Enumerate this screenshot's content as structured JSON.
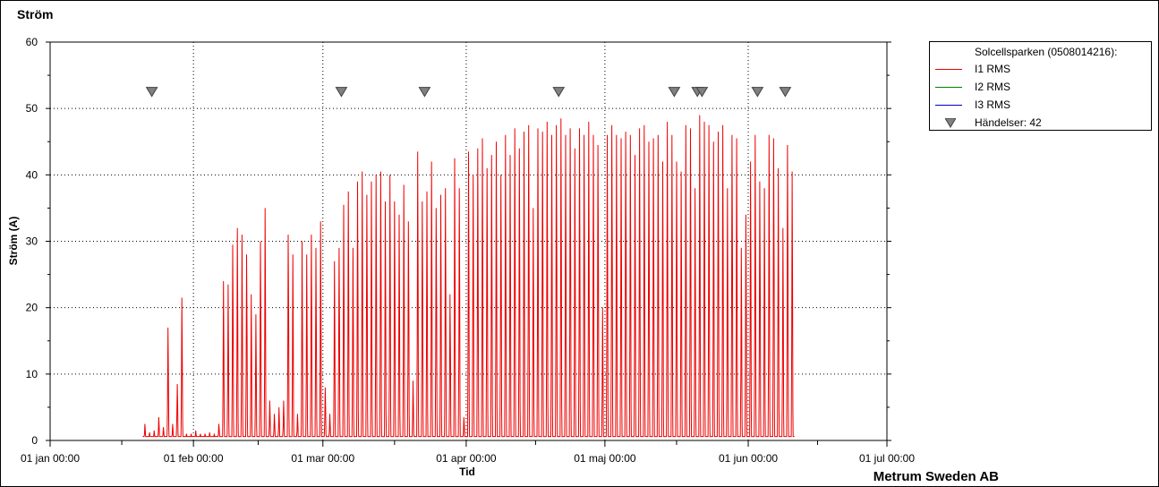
{
  "title": "Ström",
  "company": "Metrum Sweden AB",
  "legend": {
    "header": "Solcellsparken (0508014216):",
    "items": [
      {
        "label": "I1 RMS",
        "color": "#ee0000",
        "kind": "line"
      },
      {
        "label": "I2 RMS",
        "color": "#008000",
        "kind": "line"
      },
      {
        "label": "I3 RMS",
        "color": "#0000cc",
        "kind": "line"
      },
      {
        "label": "Händelser: 42",
        "color": "#808080",
        "kind": "marker"
      }
    ]
  },
  "chart_data": {
    "type": "line",
    "title": "Ström",
    "xlabel": "Tid",
    "ylabel": "Ström (A)",
    "ylim": [
      0,
      60
    ],
    "yticks": [
      0,
      10,
      20,
      30,
      40,
      50,
      60
    ],
    "x_tick_labels": [
      "01 jan 00:00",
      "01 feb 00:00",
      "01 mar 00:00",
      "01 apr 00:00",
      "01 maj 00:00",
      "01 jun 00:00",
      "01 jul 00:00"
    ],
    "x_tick_days": [
      0,
      31,
      59,
      90,
      120,
      151,
      181
    ],
    "xlim_days": [
      0,
      181
    ],
    "grid": true,
    "legend_position": "top-right",
    "series": [
      {
        "name": "I1 RMS",
        "color": "#ee0000",
        "daily_peaks": [
          {
            "day": 20,
            "peak": 2.5
          },
          {
            "day": 21,
            "peak": 1.2
          },
          {
            "day": 22,
            "peak": 1.5
          },
          {
            "day": 23,
            "peak": 3.5
          },
          {
            "day": 24,
            "peak": 2.0
          },
          {
            "day": 25,
            "peak": 17.0
          },
          {
            "day": 26,
            "peak": 2.5
          },
          {
            "day": 27,
            "peak": 8.5
          },
          {
            "day": 28,
            "peak": 21.5
          },
          {
            "day": 29,
            "peak": 1.0
          },
          {
            "day": 30,
            "peak": 1.0
          },
          {
            "day": 31,
            "peak": 1.5
          },
          {
            "day": 32,
            "peak": 1.0
          },
          {
            "day": 33,
            "peak": 1.0
          },
          {
            "day": 34,
            "peak": 1.2
          },
          {
            "day": 35,
            "peak": 1.0
          },
          {
            "day": 36,
            "peak": 2.5
          },
          {
            "day": 37,
            "peak": 24.0
          },
          {
            "day": 38,
            "peak": 23.5
          },
          {
            "day": 39,
            "peak": 29.5
          },
          {
            "day": 40,
            "peak": 32.0
          },
          {
            "day": 41,
            "peak": 31.0
          },
          {
            "day": 42,
            "peak": 28.0
          },
          {
            "day": 43,
            "peak": 22.0
          },
          {
            "day": 44,
            "peak": 19.0
          },
          {
            "day": 45,
            "peak": 30.0
          },
          {
            "day": 46,
            "peak": 35.0
          },
          {
            "day": 47,
            "peak": 6.0
          },
          {
            "day": 48,
            "peak": 4.0
          },
          {
            "day": 49,
            "peak": 5.0
          },
          {
            "day": 50,
            "peak": 6.0
          },
          {
            "day": 51,
            "peak": 31.0
          },
          {
            "day": 52,
            "peak": 28.0
          },
          {
            "day": 53,
            "peak": 4.0
          },
          {
            "day": 54,
            "peak": 30.0
          },
          {
            "day": 55,
            "peak": 28.0
          },
          {
            "day": 56,
            "peak": 31.0
          },
          {
            "day": 57,
            "peak": 29.0
          },
          {
            "day": 58,
            "peak": 33.0
          },
          {
            "day": 59,
            "peak": 8.0
          },
          {
            "day": 60,
            "peak": 4.0
          },
          {
            "day": 61,
            "peak": 27.0
          },
          {
            "day": 62,
            "peak": 29.0
          },
          {
            "day": 63,
            "peak": 35.5
          },
          {
            "day": 64,
            "peak": 37.5
          },
          {
            "day": 65,
            "peak": 29.0
          },
          {
            "day": 66,
            "peak": 39.0
          },
          {
            "day": 67,
            "peak": 40.5
          },
          {
            "day": 68,
            "peak": 37.0
          },
          {
            "day": 69,
            "peak": 39.0
          },
          {
            "day": 70,
            "peak": 40.0
          },
          {
            "day": 71,
            "peak": 40.5
          },
          {
            "day": 72,
            "peak": 36.0
          },
          {
            "day": 73,
            "peak": 40.0
          },
          {
            "day": 74,
            "peak": 36.0
          },
          {
            "day": 75,
            "peak": 34.0
          },
          {
            "day": 76,
            "peak": 38.5
          },
          {
            "day": 77,
            "peak": 33.0
          },
          {
            "day": 78,
            "peak": 9.0
          },
          {
            "day": 79,
            "peak": 43.5
          },
          {
            "day": 80,
            "peak": 36.0
          },
          {
            "day": 81,
            "peak": 37.5
          },
          {
            "day": 82,
            "peak": 42.0
          },
          {
            "day": 83,
            "peak": 35.0
          },
          {
            "day": 84,
            "peak": 37.0
          },
          {
            "day": 85,
            "peak": 38.0
          },
          {
            "day": 86,
            "peak": 22.0
          },
          {
            "day": 87,
            "peak": 42.5
          },
          {
            "day": 88,
            "peak": 38.0
          },
          {
            "day": 89,
            "peak": 3.5
          },
          {
            "day": 90,
            "peak": 43.5
          },
          {
            "day": 91,
            "peak": 40.0
          },
          {
            "day": 92,
            "peak": 44.0
          },
          {
            "day": 93,
            "peak": 45.5
          },
          {
            "day": 94,
            "peak": 41.0
          },
          {
            "day": 95,
            "peak": 43.0
          },
          {
            "day": 96,
            "peak": 45.0
          },
          {
            "day": 97,
            "peak": 40.0
          },
          {
            "day": 98,
            "peak": 46.0
          },
          {
            "day": 99,
            "peak": 43.0
          },
          {
            "day": 100,
            "peak": 47.0
          },
          {
            "day": 101,
            "peak": 44.0
          },
          {
            "day": 102,
            "peak": 46.5
          },
          {
            "day": 103,
            "peak": 47.5
          },
          {
            "day": 104,
            "peak": 35.0
          },
          {
            "day": 105,
            "peak": 47.0
          },
          {
            "day": 106,
            "peak": 46.5
          },
          {
            "day": 107,
            "peak": 48.0
          },
          {
            "day": 108,
            "peak": 46.0
          },
          {
            "day": 109,
            "peak": 47.5
          },
          {
            "day": 110,
            "peak": 48.5
          },
          {
            "day": 111,
            "peak": 46.0
          },
          {
            "day": 112,
            "peak": 47.0
          },
          {
            "day": 113,
            "peak": 44.0
          },
          {
            "day": 114,
            "peak": 47.0
          },
          {
            "day": 115,
            "peak": 46.0
          },
          {
            "day": 116,
            "peak": 48.0
          },
          {
            "day": 117,
            "peak": 46.0
          },
          {
            "day": 118,
            "peak": 44.5
          },
          {
            "day": 119,
            "peak": 20.0
          },
          {
            "day": 120,
            "peak": 46.0
          },
          {
            "day": 121,
            "peak": 47.5
          },
          {
            "day": 122,
            "peak": 46.0
          },
          {
            "day": 123,
            "peak": 45.5
          },
          {
            "day": 124,
            "peak": 46.5
          },
          {
            "day": 125,
            "peak": 46.0
          },
          {
            "day": 126,
            "peak": 43.0
          },
          {
            "day": 127,
            "peak": 47.0
          },
          {
            "day": 128,
            "peak": 47.5
          },
          {
            "day": 129,
            "peak": 45.0
          },
          {
            "day": 130,
            "peak": 45.5
          },
          {
            "day": 131,
            "peak": 46.0
          },
          {
            "day": 132,
            "peak": 42.0
          },
          {
            "day": 133,
            "peak": 48.0
          },
          {
            "day": 134,
            "peak": 46.0
          },
          {
            "day": 135,
            "peak": 42.0
          },
          {
            "day": 136,
            "peak": 40.5
          },
          {
            "day": 137,
            "peak": 47.5
          },
          {
            "day": 138,
            "peak": 47.0
          },
          {
            "day": 139,
            "peak": 38.0
          },
          {
            "day": 140,
            "peak": 49.0
          },
          {
            "day": 141,
            "peak": 48.0
          },
          {
            "day": 142,
            "peak": 47.5
          },
          {
            "day": 143,
            "peak": 45.0
          },
          {
            "day": 144,
            "peak": 46.5
          },
          {
            "day": 145,
            "peak": 47.5
          },
          {
            "day": 146,
            "peak": 38.0
          },
          {
            "day": 147,
            "peak": 46.0
          },
          {
            "day": 148,
            "peak": 45.5
          },
          {
            "day": 149,
            "peak": 29.0
          },
          {
            "day": 150,
            "peak": 34.0
          },
          {
            "day": 151,
            "peak": 42.0
          },
          {
            "day": 152,
            "peak": 46.0
          },
          {
            "day": 153,
            "peak": 39.0
          },
          {
            "day": 154,
            "peak": 38.0
          },
          {
            "day": 155,
            "peak": 46.0
          },
          {
            "day": 156,
            "peak": 45.5
          },
          {
            "day": 157,
            "peak": 41.0
          },
          {
            "day": 158,
            "peak": 32.0
          },
          {
            "day": 159,
            "peak": 44.5
          },
          {
            "day": 160,
            "peak": 40.5
          }
        ]
      },
      {
        "name": "I2 RMS",
        "color": "#008000",
        "note_visible": false,
        "daily_peaks": []
      },
      {
        "name": "I3 RMS",
        "color": "#0000cc",
        "daily_peaks": []
      }
    ],
    "events": {
      "label": "Händelser: 42",
      "days": [
        22,
        63,
        81,
        110,
        135,
        140,
        141,
        153,
        159
      ],
      "y_value": 52.5
    }
  }
}
